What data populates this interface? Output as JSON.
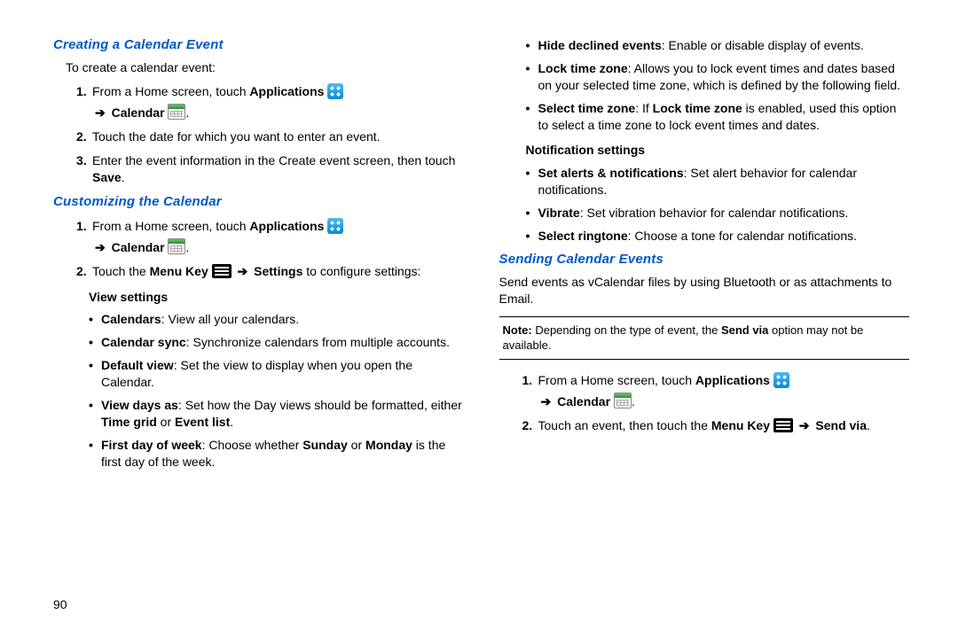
{
  "page_number": "90",
  "left": {
    "s1_title": "Creating a Calendar Event",
    "s1_lead": "To create a calendar event:",
    "s1_1_a": "From a Home screen, touch ",
    "s1_1_app": "Applications",
    "s1_1_cal": "Calendar",
    "s1_1_dot": ".",
    "s1_2": "Touch the date for which you want to enter an event.",
    "s1_3_a": "Enter the event information in the Create event screen, then touch ",
    "s1_3_save": "Save",
    "s1_3_dot": ".",
    "s2_title": "Customizing the Calendar",
    "s2_1_a": "From a Home screen, touch ",
    "s2_1_app": "Applications",
    "s2_1_cal": "Calendar",
    "s2_1_dot": ".",
    "s2_2_a": "Touch the ",
    "s2_2_mk": "Menu Key",
    "s2_2_b": " ",
    "s2_2_set": "Settings",
    "s2_2_c": " to configure settings:",
    "view_head": "View settings",
    "v1_b": "Calendars",
    "v1_t": ": View all your calendars.",
    "v2_b": "Calendar sync",
    "v2_t": ": Synchronize calendars from multiple accounts.",
    "v3_b": "Default view",
    "v3_t": ": Set the view to display when you open the Calendar.",
    "v4_b": "View days as",
    "v4_t_a": ": Set how the Day views should be formatted, either ",
    "v4_tg": "Time grid",
    "v4_or": " or ",
    "v4_el": "Event list",
    "v4_dot": ".",
    "v5_b": "First day of week",
    "v5_t_a": ": Choose whether ",
    "v5_sun": "Sunday",
    "v5_mid": " or ",
    "v5_mon": "Monday",
    "v5_t_b": " is the first day of the week."
  },
  "right": {
    "r1_b": "Hide declined events",
    "r1_t": ": Enable or disable display of events.",
    "r2_b": "Lock time zone",
    "r2_t": ": Allows you to lock event times and dates based on your selected time zone, which is defined by the following field.",
    "r3_b": "Select time zone",
    "r3_t_a": ": If ",
    "r3_ltz": "Lock time zone",
    "r3_t_b": " is enabled, used this option to select a time zone to lock event times and dates.",
    "notif_head": "Notification settings",
    "n1_b": "Set alerts & notifications",
    "n1_t": ": Set alert behavior for calendar notifications.",
    "n2_b": "Vibrate",
    "n2_t": ": Set vibration behavior for calendar notifications.",
    "n3_b": "Select ringtone",
    "n3_t": ": Choose a tone for calendar notifications.",
    "s3_title": "Sending Calendar Events",
    "s3_intro": "Send events as vCalendar files by using Bluetooth or as attachments to Email.",
    "note_b": "Note:",
    "note_t_a": " Depending on the type of event, the ",
    "note_sv": "Send via",
    "note_t_b": " option may not be available.",
    "s3_1_a": "From a Home screen, touch ",
    "s3_1_app": "Applications",
    "s3_1_cal": "Calendar",
    "s3_1_dot": ".",
    "s3_2_a": "Touch an event, then touch the ",
    "s3_2_mk": "Menu Key",
    "s3_2_sv": "Send via",
    "s3_2_dot": ".",
    "arrow": "➔"
  }
}
